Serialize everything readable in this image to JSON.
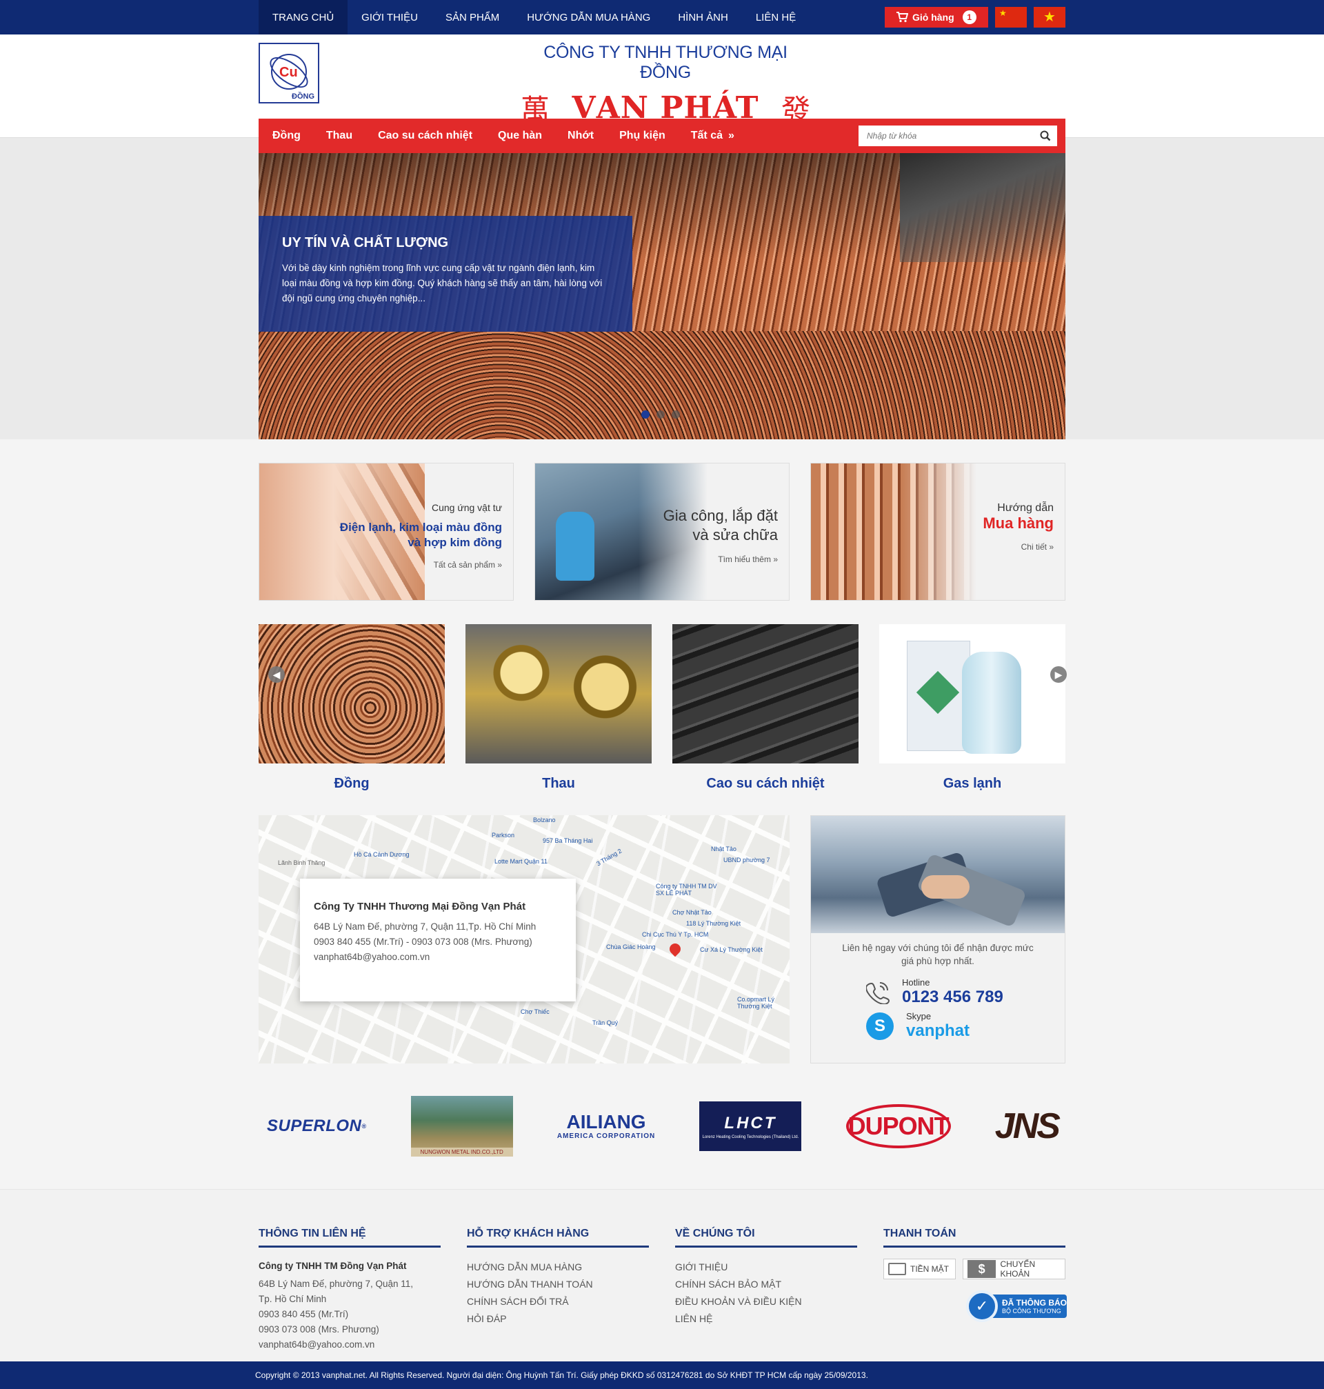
{
  "topnav": {
    "items": [
      {
        "label": "TRANG CHỦ",
        "active": true
      },
      {
        "label": "GIỚI THIỆU"
      },
      {
        "label": "SẢN PHẨM"
      },
      {
        "label": "HƯỚNG DẪN MUA HÀNG"
      },
      {
        "label": "HÌNH ẢNH"
      },
      {
        "label": "LIÊN HỆ"
      }
    ],
    "cart_label": "Giỏ hàng",
    "cart_count": "1"
  },
  "header": {
    "logo_text": "Cu",
    "logo_sub": "ĐỒNG",
    "company_line": "CÔNG TY TNHH THƯƠNG MẠI ĐỒNG",
    "hanzi_left": "萬",
    "brand_name": "VẠN PHÁT",
    "hanzi_right": "發"
  },
  "catnav": {
    "items": [
      "Đồng",
      "Thau",
      "Cao su cách nhiệt",
      "Que hàn",
      "Nhớt",
      "Phụ kiện",
      "Tất cả"
    ],
    "search_placeholder": "Nhập từ khóa"
  },
  "slider": {
    "title": "UY TÍN VÀ CHẤT LƯỢNG",
    "text": "Với bề dày kinh nghiệm trong lĩnh vực cung cấp vật tư ngành điện lạnh, kim loại màu đồng và hợp kim đồng. Quý khách hàng sẽ thấy an tâm, hài lòng với đội ngũ cung ứng chuyên nghiệp..."
  },
  "promos": [
    {
      "small": "Cung ứng vật tư",
      "line1": "Điện lạnh, kim loại màu đồng",
      "line2": "và hợp kim đồng",
      "more": "Tất cả sản phẩm"
    },
    {
      "line1": "Gia công, lắp đặt",
      "line2": "và sửa chữa",
      "more": "Tìm hiểu thêm"
    },
    {
      "small": "Hướng dẫn",
      "line1": "Mua hàng",
      "more": "Chi tiết"
    }
  ],
  "products": [
    {
      "name": "Đồng"
    },
    {
      "name": "Thau"
    },
    {
      "name": "Cao su cách nhiệt"
    },
    {
      "name": "Gas lạnh"
    }
  ],
  "map": {
    "company": "Công Ty TNHH Thương Mại Đồng Vạn Phát",
    "address": "64B Lý Nam Đế, phường 7, Quận 11,Tp. Hồ Chí Minh",
    "phones": "0903 840 455 (Mr.Trí) - 0903 073 008 (Mrs. Phương)",
    "email": "vanphat64b@yahoo.com.vn",
    "labels": [
      "Bolzano",
      "Parkson",
      "957 Ba Tháng Hai",
      "Hồ Cá Cảnh Dương",
      "Lotte Mart Quận 11",
      "3 Tháng 2",
      "Nhật Tảo",
      "UBND phường 7",
      "Công ty TNHH TM DV SX LÊ PHÁT",
      "Chợ Nhật Tảo",
      "118 Lý Thường Kiệt",
      "Chi Cục Thú Y Tp. HCM",
      "Chùa Giác Hoàng",
      "Cư Xá Lý Thường Kiệt",
      "Co.opmart Lý Thường Kiệt",
      "Chợ Thiếc",
      "Trần Quý",
      "Lãnh Binh Thăng"
    ]
  },
  "contact": {
    "intro": "Liên hệ ngay với chúng tôi để nhận được mức giá phù hợp nhất.",
    "hotline_label": "Hotline",
    "hotline": "0123 456 789",
    "skype_label": "Skype",
    "skype": "vanphat"
  },
  "partners": {
    "superlon": "SUPERLON",
    "nungwon": "NUNGWON METAL IND.CO.,LTD",
    "ailiang": "AILIANG",
    "ailiang_sub": "AMERICA CORPORATION",
    "lhct": "LHCT",
    "lhct_sub": "Lorenz Heating Cooling Technologies (Thailand) Ltd.",
    "dupont": "DUPONT",
    "jns": "JNS"
  },
  "footer": {
    "col1": {
      "title": "THÔNG TIN LIÊN HỆ",
      "company": "Công ty TNHH TM Đồng Vạn Phát",
      "addr1": "64B Lý Nam Đế, phường 7, Quận 11,",
      "addr2": "Tp. Hồ Chí Minh",
      "phone1": "0903 840 455 (Mr.Trí)",
      "phone2": "0903 073 008 (Mrs. Phương)",
      "email": "vanphat64b@yahoo.com.vn"
    },
    "col2": {
      "title": "HỖ TRỢ KHÁCH HÀNG",
      "links": [
        "HƯỚNG DẪN MUA HÀNG",
        "HƯỚNG DẪN THANH TOÁN",
        "CHÍNH SÁCH ĐỔI TRẢ",
        "HỎI ĐÁP"
      ]
    },
    "col3": {
      "title": "VỀ CHÚNG TÔI",
      "links": [
        "GIỚI THIỆU",
        "CHÍNH SÁCH BẢO MẬT",
        "ĐIỀU KHOẢN VÀ ĐIỀU KIỆN",
        "LIÊN HỆ"
      ]
    },
    "col4": {
      "title": "THANH TOÁN",
      "cash": "TIỀN MẶT",
      "transfer": "CHUYỂN KHOẢN",
      "badge1": "ĐÃ THÔNG BÁO",
      "badge2": "BỘ CÔNG THƯƠNG"
    }
  },
  "copyright": "Copyright © 2013 vanphat.net. All Rights Reserved. Người đại diện: Ông Huỳnh Tấn Trí. Giấy phép ĐKKD số 0312476281 do Sở KHĐT TP HCM cấp ngày 25/09/2013.",
  "colors": {
    "navy": "#0f2a73",
    "red": "#e22a2a",
    "blue": "#1b3d9b"
  }
}
